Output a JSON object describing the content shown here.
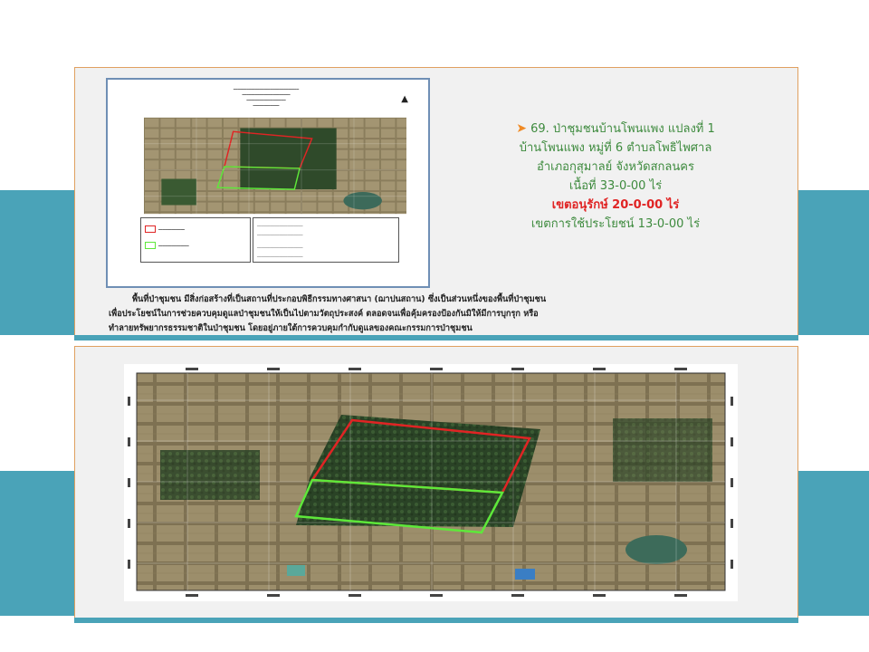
{
  "plot": {
    "arrow": "➤",
    "line1": "69. ป่าชุมชนบ้านโพนแพง  แปลงที่ 1",
    "line2": "บ้านโพนแพง  หมู่ที่  6  ตำบลโพธิไพศาล",
    "line3": "อำเภอกุสุมาลย์  จังหวัดสกลนคร",
    "line4": "เนื้อที่  33-0-00  ไร่",
    "conservation": "เขตอนุรักษ์  20-0-00  ไร่",
    "utilization": "เขตการใช้ประโยชน์   13-0-00   ไร่"
  },
  "description": {
    "line1": "พื้นที่ป่าชุมชน มีสิ่งก่อสร้างที่เป็นสถานที่ประกอบพิธีกรรมทางศาสนา (ฌาปนสถาน)  ซึ่งเป็นส่วนหนึ่งของพื้นที่ป่าชุมชน",
    "line2": "เพื่อประโยชน์ในการช่วยควบคุมดูแลป่าชุมชนให้เป็นไปตามวัตถุประสงค์ ตลอดจนเพื่อคุ้มครองป้องกันมิให้มีการบุกรุก หรือ",
    "line3": "ทำลายทรัพยากรธรรมชาติในป่าชุมชน โดยอยู่ภายใต้การควบคุมกำกับดูแลของคณะกรรมการป่าชุมชน"
  },
  "colors": {
    "conservation_zone": "#e02424",
    "utilization_zone": "#5ee83a",
    "accent_band": "#4aa3b8",
    "panel_border": "#e0a060",
    "text_green": "#3d8a3d",
    "arrow": "#f08a24"
  },
  "icons": {
    "north_arrow": "north-arrow-icon"
  }
}
